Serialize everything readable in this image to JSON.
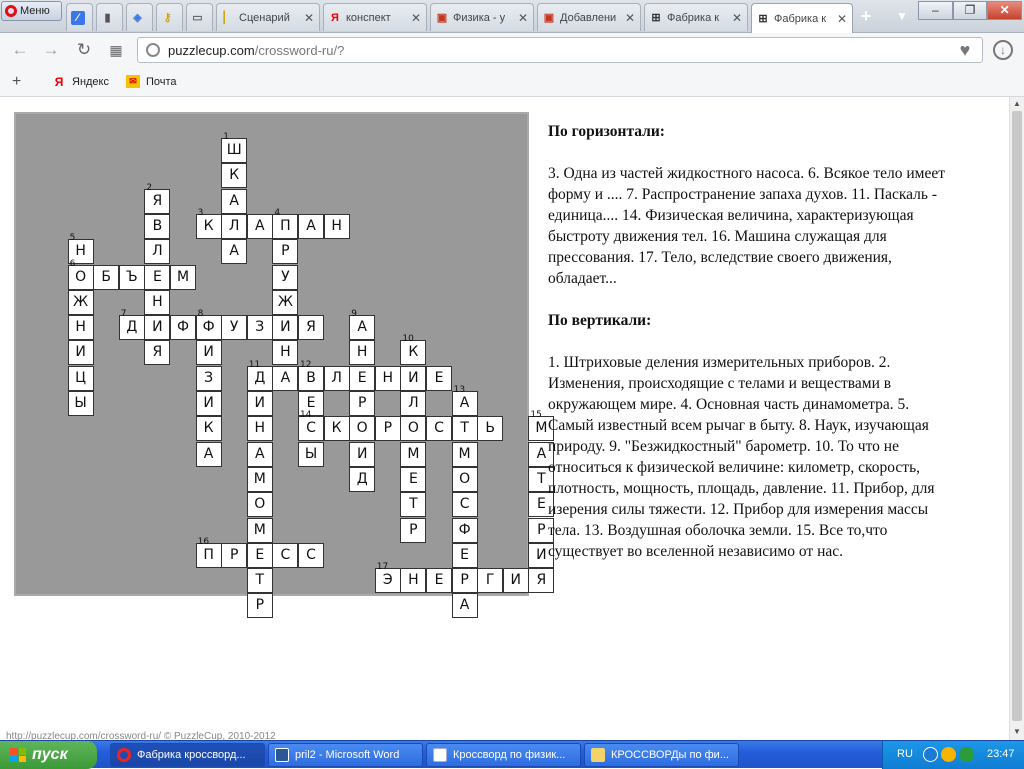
{
  "browser": {
    "menu_label": "Меню",
    "tabs": [
      {
        "label": "",
        "icon": "speed-dial-icon"
      },
      {
        "label": "",
        "icon": "document-icon"
      },
      {
        "label": "",
        "icon": "compass-icon"
      },
      {
        "label": "",
        "icon": "key-icon"
      },
      {
        "label": "",
        "icon": "screen-icon"
      },
      {
        "label": "Сценарий",
        "icon": "page-icon"
      },
      {
        "label": "конспект",
        "icon": "yandex-icon"
      },
      {
        "label": "Физика - у",
        "icon": "briefcase-icon"
      },
      {
        "label": "Добавлени",
        "icon": "briefcase-icon"
      },
      {
        "label": "Фабрика к",
        "icon": "crossword-icon"
      },
      {
        "label": "Фабрика к",
        "icon": "crossword-icon"
      }
    ],
    "url_domain": "puzzlecup.com",
    "url_path": "/crossword-ru/?",
    "bookmarks": [
      {
        "label": "Яндекс",
        "icon": "yandex-icon"
      },
      {
        "label": "Почта",
        "icon": "mail-icon"
      }
    ]
  },
  "crossword": {
    "cells": [
      {
        "r": 0,
        "c": 7,
        "ch": "Ш",
        "n": "1"
      },
      {
        "r": 1,
        "c": 7,
        "ch": "К"
      },
      {
        "r": 2,
        "c": 4,
        "ch": "Я",
        "n": "2"
      },
      {
        "r": 2,
        "c": 7,
        "ch": "А"
      },
      {
        "r": 3,
        "c": 4,
        "ch": "В"
      },
      {
        "r": 3,
        "c": 6,
        "ch": "К",
        "n": "3"
      },
      {
        "r": 3,
        "c": 7,
        "ch": "Л"
      },
      {
        "r": 3,
        "c": 8,
        "ch": "А"
      },
      {
        "r": 3,
        "c": 9,
        "ch": "П",
        "n": "4"
      },
      {
        "r": 3,
        "c": 10,
        "ch": "А"
      },
      {
        "r": 3,
        "c": 11,
        "ch": "Н"
      },
      {
        "r": 4,
        "c": 1,
        "ch": "Н",
        "n": "5"
      },
      {
        "r": 4,
        "c": 4,
        "ch": "Л"
      },
      {
        "r": 4,
        "c": 7,
        "ch": "А"
      },
      {
        "r": 4,
        "c": 9,
        "ch": "Р"
      },
      {
        "r": 5,
        "c": 1,
        "ch": "О",
        "n": "6"
      },
      {
        "r": 5,
        "c": 2,
        "ch": "Б"
      },
      {
        "r": 5,
        "c": 3,
        "ch": "Ъ"
      },
      {
        "r": 5,
        "c": 4,
        "ch": "Е"
      },
      {
        "r": 5,
        "c": 5,
        "ch": "М"
      },
      {
        "r": 5,
        "c": 9,
        "ch": "У"
      },
      {
        "r": 6,
        "c": 1,
        "ch": "Ж"
      },
      {
        "r": 6,
        "c": 4,
        "ch": "Н"
      },
      {
        "r": 6,
        "c": 9,
        "ch": "Ж"
      },
      {
        "r": 7,
        "c": 1,
        "ch": "Н"
      },
      {
        "r": 7,
        "c": 3,
        "ch": "Д",
        "n": "7"
      },
      {
        "r": 7,
        "c": 4,
        "ch": "И"
      },
      {
        "r": 7,
        "c": 5,
        "ch": "Ф"
      },
      {
        "r": 7,
        "c": 6,
        "ch": "Ф",
        "n": "8"
      },
      {
        "r": 7,
        "c": 7,
        "ch": "У"
      },
      {
        "r": 7,
        "c": 8,
        "ch": "З"
      },
      {
        "r": 7,
        "c": 9,
        "ch": "И"
      },
      {
        "r": 7,
        "c": 10,
        "ch": "Я"
      },
      {
        "r": 7,
        "c": 12,
        "ch": "А",
        "n": "9"
      },
      {
        "r": 8,
        "c": 1,
        "ch": "И"
      },
      {
        "r": 8,
        "c": 4,
        "ch": "Я"
      },
      {
        "r": 8,
        "c": 6,
        "ch": "И"
      },
      {
        "r": 8,
        "c": 9,
        "ch": "Н"
      },
      {
        "r": 8,
        "c": 12,
        "ch": "Н"
      },
      {
        "r": 8,
        "c": 14,
        "ch": "К",
        "n": "10"
      },
      {
        "r": 9,
        "c": 1,
        "ch": "Ц"
      },
      {
        "r": 9,
        "c": 6,
        "ch": "З"
      },
      {
        "r": 9,
        "c": 8,
        "ch": "Д",
        "n": "11"
      },
      {
        "r": 9,
        "c": 9,
        "ch": "А"
      },
      {
        "r": 9,
        "c": 10,
        "ch": "В",
        "n": "12"
      },
      {
        "r": 9,
        "c": 11,
        "ch": "Л"
      },
      {
        "r": 9,
        "c": 12,
        "ch": "Е"
      },
      {
        "r": 9,
        "c": 13,
        "ch": "Н"
      },
      {
        "r": 9,
        "c": 14,
        "ch": "И"
      },
      {
        "r": 9,
        "c": 15,
        "ch": "Е"
      },
      {
        "r": 10,
        "c": 1,
        "ch": "Ы"
      },
      {
        "r": 10,
        "c": 6,
        "ch": "И"
      },
      {
        "r": 10,
        "c": 8,
        "ch": "И"
      },
      {
        "r": 10,
        "c": 10,
        "ch": "Е"
      },
      {
        "r": 10,
        "c": 12,
        "ch": "Р"
      },
      {
        "r": 10,
        "c": 14,
        "ch": "Л"
      },
      {
        "r": 10,
        "c": 16,
        "ch": "А",
        "n": "13"
      },
      {
        "r": 11,
        "c": 6,
        "ch": "К"
      },
      {
        "r": 11,
        "c": 8,
        "ch": "Н"
      },
      {
        "r": 11,
        "c": 10,
        "ch": "С",
        "n": "14"
      },
      {
        "r": 11,
        "c": 11,
        "ch": "К"
      },
      {
        "r": 11,
        "c": 12,
        "ch": "О"
      },
      {
        "r": 11,
        "c": 13,
        "ch": "Р"
      },
      {
        "r": 11,
        "c": 14,
        "ch": "О"
      },
      {
        "r": 11,
        "c": 15,
        "ch": "С"
      },
      {
        "r": 11,
        "c": 16,
        "ch": "Т"
      },
      {
        "r": 11,
        "c": 17,
        "ch": "Ь"
      },
      {
        "r": 11,
        "c": 19,
        "ch": "М",
        "n": "15"
      },
      {
        "r": 12,
        "c": 6,
        "ch": "А"
      },
      {
        "r": 12,
        "c": 8,
        "ch": "А"
      },
      {
        "r": 12,
        "c": 10,
        "ch": "Ы"
      },
      {
        "r": 12,
        "c": 12,
        "ch": "И"
      },
      {
        "r": 12,
        "c": 14,
        "ch": "М"
      },
      {
        "r": 12,
        "c": 16,
        "ch": "М"
      },
      {
        "r": 12,
        "c": 19,
        "ch": "А"
      },
      {
        "r": 13,
        "c": 8,
        "ch": "М"
      },
      {
        "r": 13,
        "c": 12,
        "ch": "Д"
      },
      {
        "r": 13,
        "c": 14,
        "ch": "Е"
      },
      {
        "r": 13,
        "c": 16,
        "ch": "О"
      },
      {
        "r": 13,
        "c": 19,
        "ch": "Т"
      },
      {
        "r": 14,
        "c": 8,
        "ch": "О"
      },
      {
        "r": 14,
        "c": 14,
        "ch": "Т"
      },
      {
        "r": 14,
        "c": 16,
        "ch": "С"
      },
      {
        "r": 14,
        "c": 19,
        "ch": "Е"
      },
      {
        "r": 15,
        "c": 8,
        "ch": "М"
      },
      {
        "r": 15,
        "c": 14,
        "ch": "Р"
      },
      {
        "r": 15,
        "c": 16,
        "ch": "Ф"
      },
      {
        "r": 15,
        "c": 19,
        "ch": "Р"
      },
      {
        "r": 16,
        "c": 6,
        "ch": "П",
        "n": "16"
      },
      {
        "r": 16,
        "c": 7,
        "ch": "Р"
      },
      {
        "r": 16,
        "c": 8,
        "ch": "Е"
      },
      {
        "r": 16,
        "c": 9,
        "ch": "С"
      },
      {
        "r": 16,
        "c": 10,
        "ch": "С"
      },
      {
        "r": 16,
        "c": 16,
        "ch": "Е"
      },
      {
        "r": 16,
        "c": 19,
        "ch": "И"
      },
      {
        "r": 17,
        "c": 8,
        "ch": "Т"
      },
      {
        "r": 17,
        "c": 13,
        "ch": "Э",
        "n": "17"
      },
      {
        "r": 17,
        "c": 14,
        "ch": "Н"
      },
      {
        "r": 17,
        "c": 15,
        "ch": "Е"
      },
      {
        "r": 17,
        "c": 16,
        "ch": "Р"
      },
      {
        "r": 17,
        "c": 17,
        "ch": "Г"
      },
      {
        "r": 17,
        "c": 18,
        "ch": "И"
      },
      {
        "r": 17,
        "c": 19,
        "ch": "Я"
      },
      {
        "r": 18,
        "c": 8,
        "ch": "Р"
      },
      {
        "r": 18,
        "c": 16,
        "ch": "А"
      }
    ]
  },
  "clues": {
    "across_title": "По горизонтали:",
    "across_text": "3. Одна из частей жидкостного насоса.   6. Всякое тело имеет форму и ....   7. Распространение запаха духов.   11. Паскаль - единица.... 14. Физическая величина, характеризующая быстроту движения тел.   16. Машина служащая для прессования.   17. Тело, вследствие своего движения, обладает...",
    "down_title": "По вертикали:",
    "down_text": "1. Штриховые деления измерительных приборов.   2. Изменения, происходящие с телами и веществами в окружающем мире.   4. Основная часть динамометра.   5. Самый известный всем рычаг в быту.   8. Наук, изучающая природу. 9. \"Безжидкостный\" барометр.   10. То что не относиться к физической величине: километр, скорость, плотность, мощность, площадь, давление.   11. Прибор, для изерения силы тяжести.   12. Прибор для измерения массы тела. 13. Воздушная оболочка земли.   15. Все то,что существует во вселенной независимо от нас."
  },
  "footer": "http://puzzlecup.com/crossword-ru/ © PuzzleCup, 2010-2012",
  "taskbar": {
    "start_label": "пуск",
    "tasks": [
      {
        "label": "Фабрика кроссворд...",
        "active": true
      },
      {
        "label": "pril2 - Microsoft Word",
        "active": false
      },
      {
        "label": "Кроссворд по физик...",
        "active": false
      },
      {
        "label": "КРОССВОРДы по фи...",
        "active": false
      }
    ],
    "lang": "RU",
    "clock": "23:47"
  }
}
